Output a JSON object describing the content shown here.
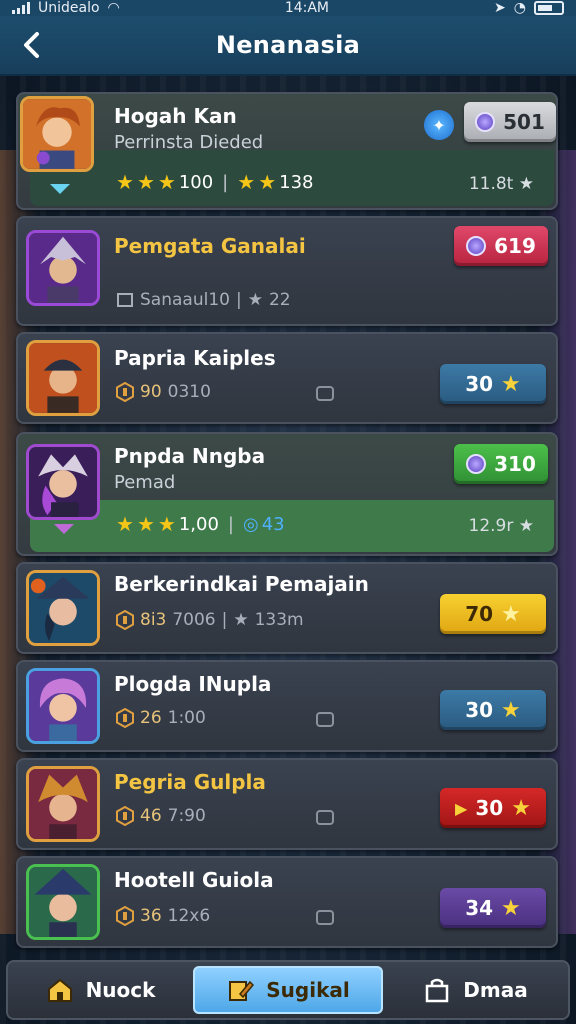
{
  "status_bar": {
    "carrier": "Unidealo",
    "time": "14:AM"
  },
  "header": {
    "title": "Nenanasia"
  },
  "rows": [
    {
      "name": "Hogah Kan",
      "subtitle": "Perrinsta Dieded",
      "badge": "501",
      "rating_left": "100",
      "rating_right": "138",
      "note": "11.8t",
      "note_icon": "star"
    },
    {
      "name": "Pemgata Ganalai",
      "badge": "619",
      "stat_a": "Sanaaul10",
      "stat_b": "22"
    },
    {
      "name": "Papria Kaiples",
      "stat_a": "90",
      "stat_b": "0310",
      "badge": "30"
    },
    {
      "name": "Pnpda Nngba",
      "subtitle": "Pemad",
      "badge": "310",
      "rating_left": "1,00",
      "rating_right": "43",
      "note": "12.9r"
    },
    {
      "name": "Berkerindkai Pemajain",
      "stat_a": "8i3",
      "stat_b": "7006",
      "stat_c": "133m",
      "badge": "70"
    },
    {
      "name": "Plogda INupla",
      "stat_a": "26",
      "stat_b": "1:00",
      "badge": "30"
    },
    {
      "name": "Pegria Gulpla",
      "stat_a": "46",
      "stat_b": "7:90",
      "badge": "30"
    },
    {
      "name": "Hootell Guiola",
      "stat_a": "36",
      "stat_b": "12x6",
      "badge": "34"
    }
  ],
  "nav": {
    "home": "Nuock",
    "center": "Sugikal",
    "right": "Dmaa"
  },
  "colors": {
    "header": "#1d4d6d",
    "gold": "#f4c542",
    "card": "#353b45"
  }
}
